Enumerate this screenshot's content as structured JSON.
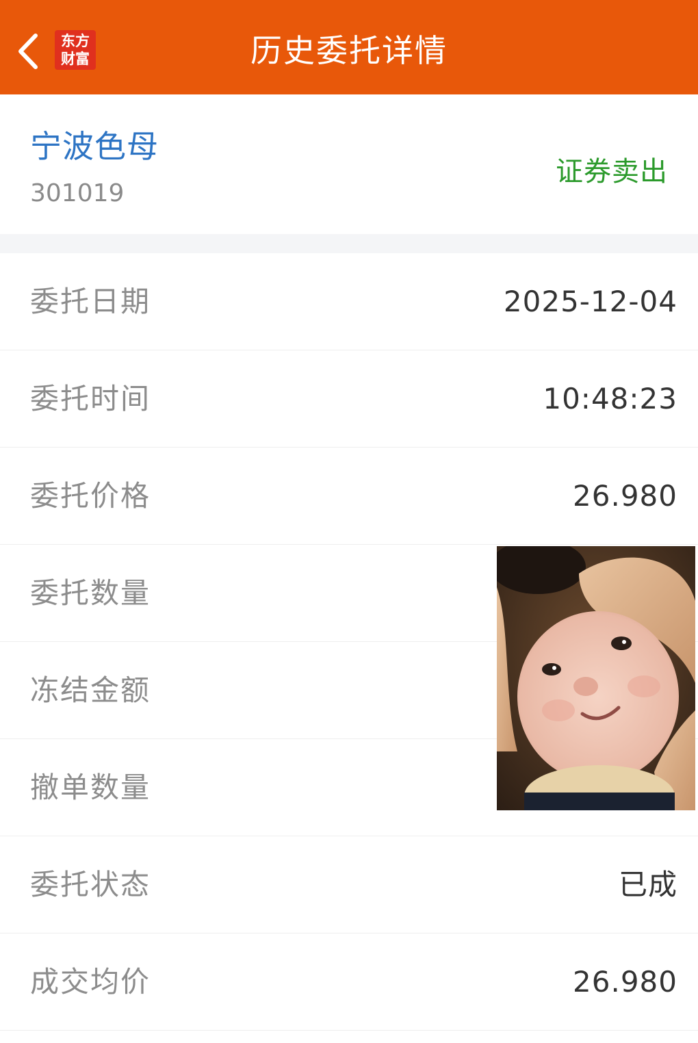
{
  "header": {
    "title": "历史委托详情",
    "logo_text": [
      "东方",
      "财富"
    ],
    "icons": {
      "back": "chevron-left-icon"
    }
  },
  "stock": {
    "name": "宁波色母",
    "code": "301019",
    "direction": "证券卖出"
  },
  "rows": [
    {
      "label": "委托日期",
      "value": "2025-12-04"
    },
    {
      "label": "委托时间",
      "value": "10:48:23"
    },
    {
      "label": "委托价格",
      "value": "26.980"
    },
    {
      "label": "委托数量",
      "value": ""
    },
    {
      "label": "冻结金额",
      "value": ""
    },
    {
      "label": "撤单数量",
      "value": ""
    },
    {
      "label": "委托状态",
      "value": "已成"
    },
    {
      "label": "成交均价",
      "value": "26.980"
    }
  ],
  "overlay_image": {
    "subject": "baby-face-photo"
  },
  "colors": {
    "header_bg": "#e8580a",
    "stock_name": "#2d74c4",
    "sell_text": "#2b9a2b",
    "label_text": "#8c8c8c",
    "value_text": "#333333"
  }
}
